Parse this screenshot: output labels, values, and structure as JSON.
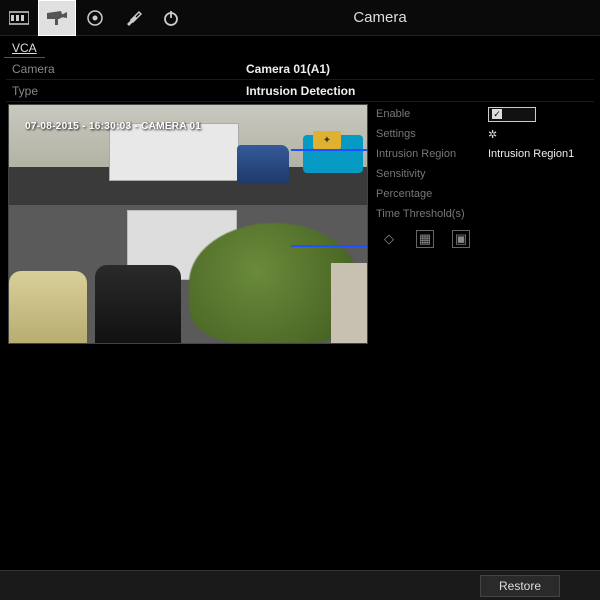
{
  "header": {
    "title": "Camera"
  },
  "tabs": {
    "vca": "VCA"
  },
  "form": {
    "camera_label": "Camera",
    "camera_value": "Camera 01(A1)",
    "type_label": "Type",
    "type_value": "Intrusion Detection"
  },
  "preview": {
    "overlay": "07-08-2015 - 16:30:03 - CAMERA 01"
  },
  "settings": {
    "enable_label": "Enable",
    "settings_label": "Settings",
    "region_label": "Intrusion Region",
    "region_value": "Intrusion Region1",
    "sensitivity_label": "Sensitivity",
    "percentage_label": "Percentage",
    "threshold_label": "Time Threshold(s)"
  },
  "footer": {
    "restore": "Restore"
  }
}
